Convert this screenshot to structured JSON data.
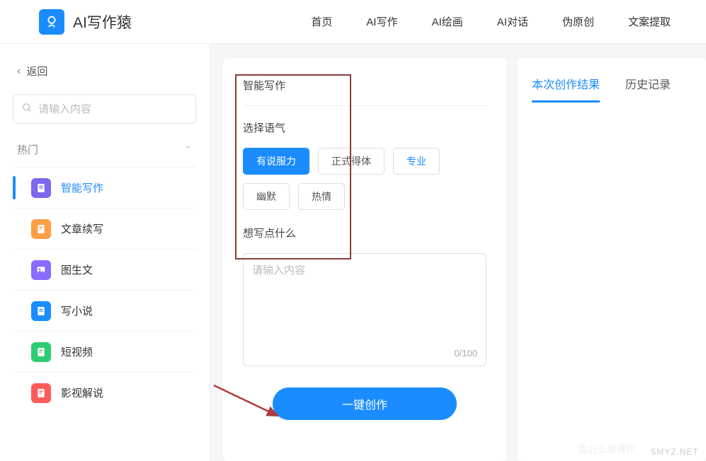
{
  "header": {
    "brand": "AI写作猿",
    "nav": [
      "首页",
      "AI写作",
      "AI绘画",
      "AI对话",
      "伪原创",
      "文案提取"
    ]
  },
  "sidebar": {
    "back": "返回",
    "search_placeholder": "请输入内容",
    "section": "热门",
    "items": [
      {
        "label": "智能写作"
      },
      {
        "label": "文章续写"
      },
      {
        "label": "图生文"
      },
      {
        "label": "写小说"
      },
      {
        "label": "短视频"
      },
      {
        "label": "影视解说"
      }
    ]
  },
  "form": {
    "title": "智能写作",
    "tone_label": "选择语气",
    "tones": [
      "有说服力",
      "正式得体",
      "专业",
      "幽默",
      "热情"
    ],
    "topic_label": "想写点什么",
    "topic_placeholder": "请输入内容",
    "counter": "0/100",
    "submit": "一键创作"
  },
  "result_tabs": {
    "current": "本次创作结果",
    "history": "历史记录"
  },
  "watermark": "SMYZ.NET",
  "watermark2": "值|什么度得邓"
}
